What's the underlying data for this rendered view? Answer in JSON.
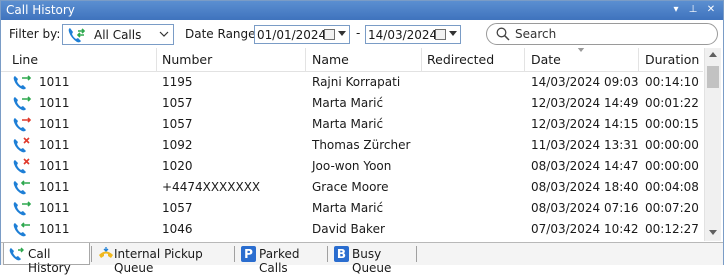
{
  "window": {
    "title": "Call History",
    "controls": {
      "menu_glyph": "▾",
      "pin_glyph": "⊥",
      "close_glyph": "✕"
    }
  },
  "filter": {
    "filter_by_label": "Filter by:",
    "calls_dropdown_value": "All Calls",
    "date_range_label": "Date Range:",
    "date_from": "01/01/2024",
    "date_separator": "-",
    "date_to": "14/03/2024",
    "search_placeholder": "Search"
  },
  "table": {
    "columns": [
      "Line",
      "Number",
      "Name",
      "Redirected",
      "Date",
      "Duration"
    ],
    "sorted_column": "Date",
    "rows": [
      {
        "call_type": "outgoing",
        "line": "1011",
        "number": "1195",
        "name": "Rajni Korrapati",
        "redirected": "",
        "date": "14/03/2024 09:03",
        "duration": "00:14:10"
      },
      {
        "call_type": "outgoing",
        "line": "1011",
        "number": "1057",
        "name": "Marta Marić",
        "redirected": "",
        "date": "12/03/2024 14:49",
        "duration": "00:01:22"
      },
      {
        "call_type": "outgoing-failed",
        "line": "1011",
        "number": "1057",
        "name": "Marta Marić",
        "redirected": "",
        "date": "12/03/2024 14:15",
        "duration": "00:00:15"
      },
      {
        "call_type": "missed",
        "line": "1011",
        "number": "1092",
        "name": "Thomas Zürcher",
        "redirected": "",
        "date": "11/03/2024 13:31",
        "duration": "00:00:00"
      },
      {
        "call_type": "missed",
        "line": "1011",
        "number": "1020",
        "name": "Joo-won Yoon",
        "redirected": "",
        "date": "08/03/2024 14:47",
        "duration": "00:00:00"
      },
      {
        "call_type": "incoming",
        "line": "1011",
        "number": "+4474XXXXXXX",
        "name": "Grace Moore",
        "redirected": "",
        "date": "08/03/2024 18:40",
        "duration": "00:04:08"
      },
      {
        "call_type": "outgoing",
        "line": "1011",
        "number": "1057",
        "name": "Marta Marić",
        "redirected": "",
        "date": "08/03/2024 07:16",
        "duration": "00:07:20"
      },
      {
        "call_type": "incoming",
        "line": "1011",
        "number": "1046",
        "name": "David Baker",
        "redirected": "",
        "date": "07/03/2024 10:42",
        "duration": "00:12:27"
      }
    ]
  },
  "tabs": [
    {
      "label": "Call History",
      "icon": "phone-icon",
      "active": true
    },
    {
      "label": "Internal Pickup Queue",
      "icon": "pickup-queue-icon",
      "active": false
    },
    {
      "label": "Parked Calls",
      "icon": "parked-calls-icon",
      "badge": "P",
      "active": false
    },
    {
      "label": "Busy Queue",
      "icon": "busy-queue-icon",
      "badge": "B",
      "active": false
    }
  ],
  "colors": {
    "titlebar": "#4a80c8",
    "phone_blue": "#1e7fd6",
    "arrow_green": "#2fa84f",
    "arrow_red": "#e03a2c",
    "missed_red": "#e03a2c",
    "badge_blue": "#2a6dcf"
  }
}
